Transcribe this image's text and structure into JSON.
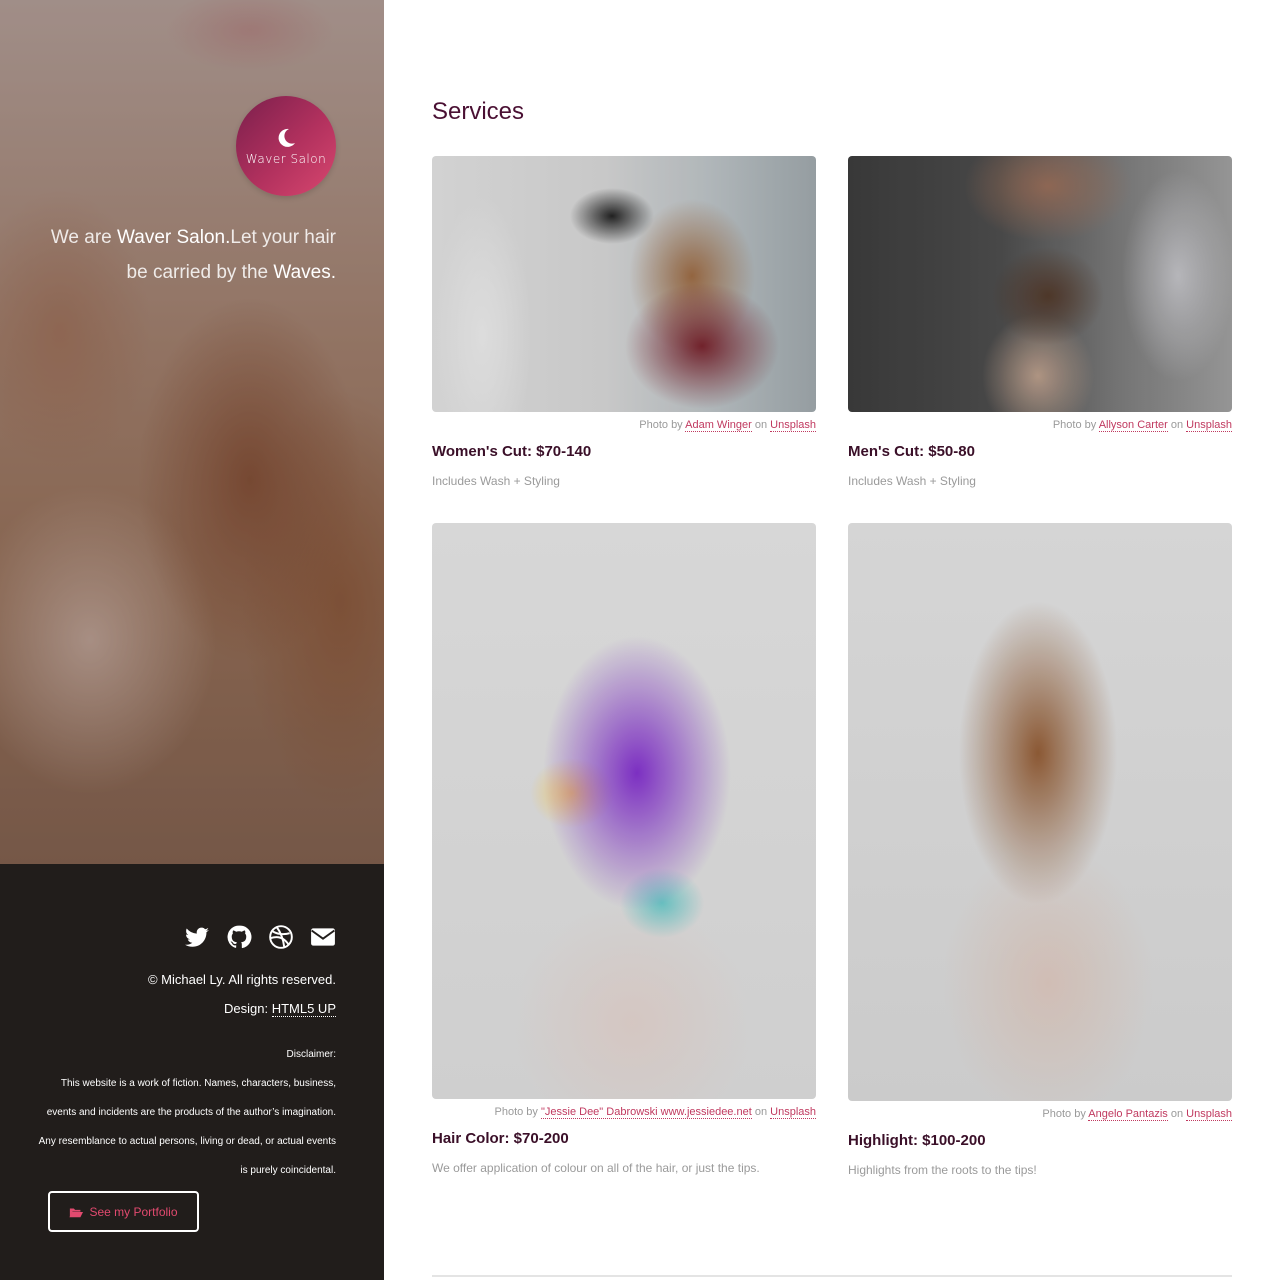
{
  "brand": {
    "logo_text": "Waver Salon",
    "accent_color": "#c0395f",
    "dark_color": "#4a1033",
    "logo_gradient": [
      "#7a1f4c",
      "#d8476f"
    ]
  },
  "tagline": {
    "part1": "We are ",
    "strong1": "Waver Salon.",
    "part2": "Let your hair be carried by the ",
    "strong2": "Waves."
  },
  "social": [
    {
      "name": "twitter-icon"
    },
    {
      "name": "github-icon"
    },
    {
      "name": "dribbble-icon"
    },
    {
      "name": "envelope-icon"
    }
  ],
  "footer": {
    "copyright": "© Michael Ly. All rights reserved.",
    "design_label": "Design: ",
    "design_link": "HTML5 UP",
    "disclaimer_lines": [
      "Disclaimer:",
      "This website is a work of fiction. Names, characters, business,",
      "events and incidents are the products of the author’s imagination.",
      "Any resemblance to actual persons, living or dead, or actual events",
      "is purely coincidental."
    ],
    "portfolio_button": "See my Portfolio"
  },
  "main": {
    "section_title": "Services",
    "credit_prefix": "Photo by ",
    "credit_on": " on ",
    "credit_site": "Unsplash",
    "services": [
      {
        "photographer": "Adam Winger",
        "title": "Women's Cut: $70-140",
        "desc": "Includes Wash + Styling"
      },
      {
        "photographer": "Allyson Carter",
        "title": "Men's Cut: $50-80",
        "desc": "Includes Wash + Styling"
      },
      {
        "photographer": "\"Jessie Dee\" Dabrowski www.jessiedee.net",
        "title": "Hair Color: $70-200",
        "desc": "We offer application of colour on all of the hair, or just the tips."
      },
      {
        "photographer": "Angelo Pantazis",
        "title": "Highlight: $100-200",
        "desc": "Highlights from the roots to the tips!"
      }
    ]
  }
}
